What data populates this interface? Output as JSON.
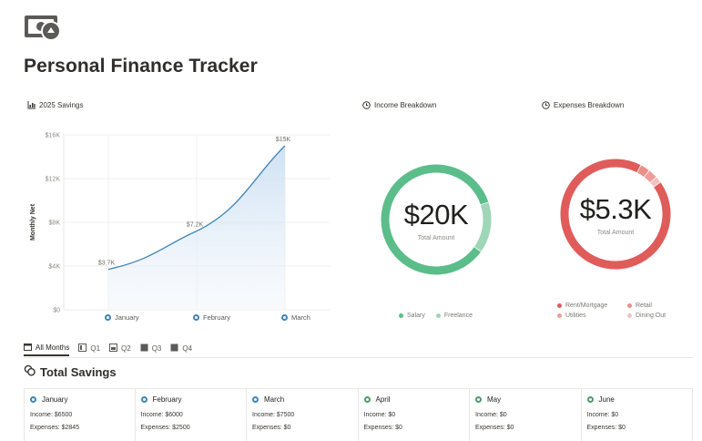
{
  "page": {
    "title": "Personal Finance Tracker",
    "icon": "money-bill-icon"
  },
  "savings_chart_header": "2025 Savings",
  "income_header": "Income Breakdown",
  "expenses_header": "Expenses Breakdown",
  "chart_data": [
    {
      "type": "area",
      "title": "2025 Savings",
      "ylabel": "Monthly Net",
      "categories": [
        "January",
        "February",
        "March"
      ],
      "series": [
        {
          "values": [
            3700,
            7200,
            15000
          ]
        }
      ],
      "data_labels": [
        "$3.7K",
        "$7.2K",
        "$15K"
      ],
      "y_ticks": [
        "$0",
        "$4K",
        "$8K",
        "$12K",
        "$16K"
      ],
      "ylim": [
        0,
        16000
      ],
      "grid": true,
      "color": "#3d84b8"
    },
    {
      "type": "pie",
      "title": "Income Breakdown",
      "center_value": "$20K",
      "center_label": "Total Amount",
      "slices": [
        {
          "name": "Salary",
          "value": 17000,
          "color": "#5bbd8a"
        },
        {
          "name": "Freelance",
          "value": 3000,
          "color": "#9ed6b7"
        }
      ]
    },
    {
      "type": "pie",
      "title": "Expenses Breakdown",
      "center_value": "$5.3K",
      "center_label": "Total Amount",
      "slices": [
        {
          "name": "Rent/Mortgage",
          "value": 4900,
          "color": "#df5c5a"
        },
        {
          "name": "Retail",
          "value": 150,
          "color": "#e8908a"
        },
        {
          "name": "Utilities",
          "value": 150,
          "color": "#ef9d9a"
        },
        {
          "name": "Dining Out",
          "value": 100,
          "color": "#f3c2bf"
        }
      ]
    }
  ],
  "income_legend": [
    "Salary",
    "Freelance"
  ],
  "expenses_legend": [
    "Rent/Mortgage",
    "Retail",
    "Utilities",
    "Dining Out"
  ],
  "tabs": [
    "All Months",
    "Q1",
    "Q2",
    "Q3",
    "Q4"
  ],
  "total_savings_title": "Total Savings",
  "months": [
    {
      "name": "January",
      "income": "Income: $6500",
      "expenses": "Expenses: $2845",
      "color": "#3d84b8"
    },
    {
      "name": "February",
      "income": "Income: $6000",
      "expenses": "Expenses: $2500",
      "color": "#3d84b8"
    },
    {
      "name": "March",
      "income": "Income: $7500",
      "expenses": "Expenses: $0",
      "color": "#3d84b8"
    },
    {
      "name": "April",
      "income": "Income: $0",
      "expenses": "Expenses: $0",
      "color": "#4c9a6a"
    },
    {
      "name": "May",
      "income": "Income: $0",
      "expenses": "Expenses: $0",
      "color": "#4c9a6a"
    },
    {
      "name": "June",
      "income": "Income: $0",
      "expenses": "Expenses: $0",
      "color": "#4c9a6a"
    }
  ]
}
